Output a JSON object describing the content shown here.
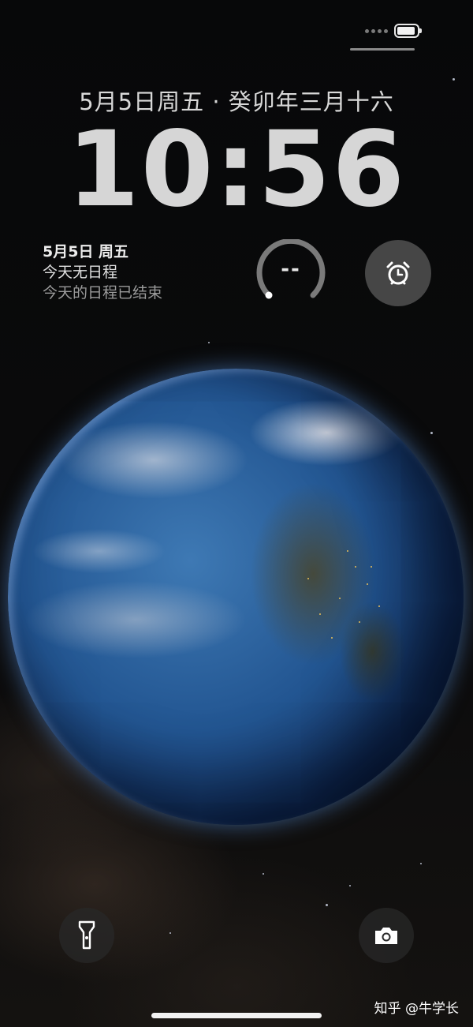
{
  "status": {
    "battery": 0.9
  },
  "lock_screen": {
    "date_line": "5月5日周五 · 癸卯年三月十六",
    "time": "10:56"
  },
  "widgets": {
    "calendar": {
      "date": "5月5日 周五",
      "line1": "今天无日程",
      "line2": "今天的日程已结束"
    },
    "gauge": {
      "value": "--"
    },
    "alarm": {
      "icon": "alarm-clock-icon"
    }
  },
  "quick_actions": {
    "left_icon": "flashlight-icon",
    "right_icon": "camera-icon"
  },
  "watermark": "知乎 @牛学长",
  "colors": {
    "background": "#050608",
    "text": "#d6d6d6",
    "ocean": "#225591"
  }
}
